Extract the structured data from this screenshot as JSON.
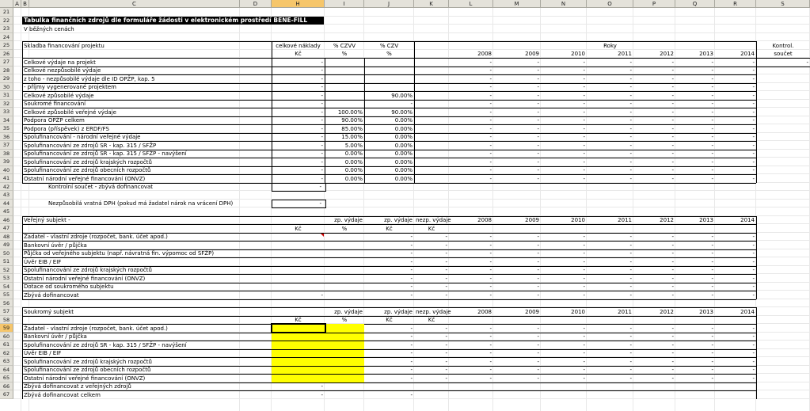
{
  "columns": [
    "A",
    "B",
    "C",
    "D",
    "H",
    "I",
    "J",
    "K",
    "L",
    "M",
    "N",
    "O",
    "P",
    "Q",
    "R",
    "S"
  ],
  "rows": [
    "21",
    "22",
    "23",
    "24",
    "25",
    "26",
    "27",
    "28",
    "29",
    "30",
    "31",
    "32",
    "33",
    "34",
    "35",
    "36",
    "37",
    "38",
    "39",
    "40",
    "41",
    "42",
    "43",
    "44",
    "45",
    "46",
    "47",
    "48",
    "49",
    "50",
    "51",
    "52",
    "53",
    "54",
    "55",
    "56",
    "57",
    "58",
    "59",
    "60",
    "61",
    "62",
    "63",
    "64",
    "65",
    "66",
    "67"
  ],
  "selected_cell": {
    "col": "H",
    "row": "59"
  },
  "title": "Tabulka finančních zdrojů dle formuláře žádosti v elektronickém prostředí BENE-FILL",
  "subtitle": "V běžných cenách",
  "sec1": {
    "label": "Skladba financování projektu",
    "col_h": "celkové náklady",
    "col_h_unit": "Kč",
    "col_i": "% CZVV",
    "col_i_unit": "%",
    "col_j": "% CZV",
    "col_j_unit": "%",
    "roky": "Roky",
    "years": [
      "2008",
      "2009",
      "2010",
      "2011",
      "2012",
      "2013",
      "2014"
    ],
    "kontrol": "Kontrol.",
    "soucet": "součet",
    "rows": [
      {
        "label": "Celkové výdaje na projekt",
        "h": "-",
        "i": "",
        "j": ""
      },
      {
        "label": "Celkové nezpůsobilé výdaje",
        "h": "-",
        "i": "",
        "j": ""
      },
      {
        "label": "z toho - nezpůsobilé výdaje dle ID OPŽP, kap. 5",
        "h": "-",
        "i": "",
        "j": ""
      },
      {
        "label": "- příjmy vygenerované projektem",
        "h": "-",
        "i": "",
        "j": ""
      },
      {
        "label": "Celkové způsobilé výdaje",
        "h": "-",
        "i": "",
        "j": "90.00%"
      },
      {
        "label": "Soukromé financování",
        "h": "-",
        "i": "",
        "j": "-"
      },
      {
        "label": "Celkové způsobilé veřejné výdaje",
        "h": "-",
        "i": "100.00%",
        "j": "90.00%"
      },
      {
        "label": "Podpora OPŽP celkem",
        "h": "-",
        "i": "90.00%",
        "j": "0.00%"
      },
      {
        "label": "Podpora (příspěvek) z ERDF/FS",
        "h": "-",
        "i": "85.00%",
        "j": "0.00%"
      },
      {
        "label": "Spolufinancování - národní veřejné výdaje",
        "h": "-",
        "i": "15.00%",
        "j": "0.00%"
      },
      {
        "label": "Spolufinancování ze zdrojů SR - kap. 315 / SFŽP",
        "h": "-",
        "i": "5.00%",
        "j": "0.00%"
      },
      {
        "label": "Spolufinancování ze zdrojů SR - kap. 315 / SFŽP - navýšení",
        "h": "-",
        "i": "0.00%",
        "j": "0.00%"
      },
      {
        "label": "Spolufinancování ze zdrojů krajských rozpočtů",
        "h": "-",
        "i": "0.00%",
        "j": "0.00%"
      },
      {
        "label": "Spolufinancování ze zdrojů obecních rozpočtů",
        "h": "-",
        "i": "0.00%",
        "j": "0.00%"
      },
      {
        "label": "Ostatní národní veřejné financování (ONVZ)",
        "h": "-",
        "i": "0.00%",
        "j": "0.00%"
      }
    ],
    "kontrolni": "Kontrolní součet - zbývá dofinancovat",
    "kontrolni_val": "-",
    "dph": "Nezpůsobilá vratná DPH (pokud má žadatel nárok na vrácení DPH)",
    "dph_val": "-"
  },
  "sec2": {
    "label": "Veřejný subjekt -",
    "col_i": "zp. výdaje",
    "col_j": "zp. výdaje",
    "col_k": "nezp. výdaje",
    "unit_h": "Kč",
    "unit_i": "%",
    "unit_j": "Kč",
    "unit_k": "Kč",
    "years": [
      "2008",
      "2009",
      "2010",
      "2011",
      "2012",
      "2013",
      "2014"
    ],
    "rows": [
      "Žadatel - vlastní zdroje (rozpočet, bank. účet apod.)",
      "Bankovní úvěr / půjčka",
      "Půjčka od veřejného subjektu (např. návratná fin. výpomoc od SFŽP)",
      "Úvěr EIB / EIF",
      "Spolufinancování ze zdrojů krajských rozpočtů",
      "Ostatní národní veřejné financování (ONVZ)",
      "Dotace od soukromého subjektu",
      "Zbývá dofinancovat"
    ]
  },
  "sec3": {
    "label": "Soukromý subjekt",
    "col_i": "zp. výdaje",
    "col_j": "zp. výdaje",
    "col_k": "nezp. výdaje",
    "unit_h": "Kč",
    "unit_i": "%",
    "unit_j": "Kč",
    "unit_k": "Kč",
    "years": [
      "2008",
      "2009",
      "2010",
      "2011",
      "2012",
      "2013",
      "2014"
    ],
    "rows": [
      "Žadatel - vlastní zdroje (rozpočet, bank. účet apod.)",
      "Bankovní úvěr / půjčka",
      "Spolufinancování ze zdrojů SR - kap. 315 / SFŽP - navýšení",
      "Úvěr EIB / EIF",
      "Spolufinancování ze zdrojů krajských rozpočtů",
      "Spolufinancování ze zdrojů obecních rozpočtů",
      "Ostatní národní veřejné financování (ONVZ)"
    ],
    "zbyva_verejne": "Zbývá dofinancovat z veřejných zdrojů",
    "zbyva_celkem": "Zbývá dofinancovat celkem"
  },
  "dash": "-",
  "colors": {
    "header_bg": "#e4e2da",
    "selected_header": "#f6c66b",
    "title_bg": "#000000",
    "input_fill": "#ffff00",
    "grid": "#e8e8e8"
  }
}
